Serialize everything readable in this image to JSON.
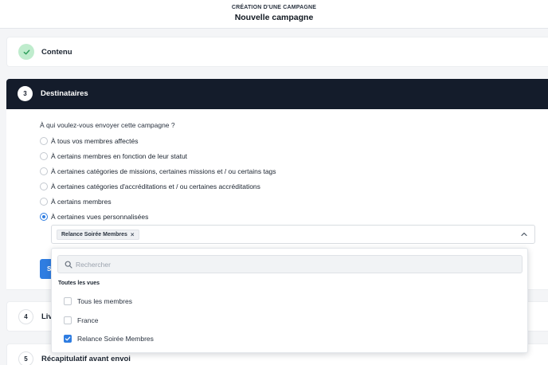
{
  "header": {
    "overline": "CRÉATION D'UNE CAMPAGNE",
    "title": "Nouvelle campagne"
  },
  "steps": {
    "contenu": {
      "title": "Contenu",
      "status": "completed"
    },
    "destinataires": {
      "number": "3",
      "title": "Destinataires"
    },
    "livraison": {
      "number": "4",
      "title": "Liv"
    },
    "recap": {
      "number": "5",
      "title": "Récapitulatif avant envoi"
    }
  },
  "recipients": {
    "question": "À qui voulez-vous envoyer cette campagne ?",
    "options": [
      {
        "label": "À tous vos membres affectés",
        "selected": false
      },
      {
        "label": "À certains membres en fonction de leur statut",
        "selected": false
      },
      {
        "label": "À certaines catégories de missions, certaines missions et / ou certains tags",
        "selected": false
      },
      {
        "label": "À certaines catégories d'accréditations et / ou certaines accréditations",
        "selected": false
      },
      {
        "label": "À certains membres",
        "selected": false
      },
      {
        "label": "À certaines vues personnalisées",
        "selected": true
      }
    ],
    "selected_chip": "Relance Soirée Membres",
    "submit_label": "S"
  },
  "dropdown": {
    "search_placeholder": "Rechercher",
    "group_label": "Toutes les vues",
    "items": [
      {
        "label": "Tous les membres",
        "checked": false
      },
      {
        "label": "France",
        "checked": false
      },
      {
        "label": "Relance Soirée Membres",
        "checked": true
      }
    ]
  },
  "colors": {
    "accent": "#2f7de1",
    "dark_header": "#141c2b",
    "success_bg": "#bfeccd"
  }
}
